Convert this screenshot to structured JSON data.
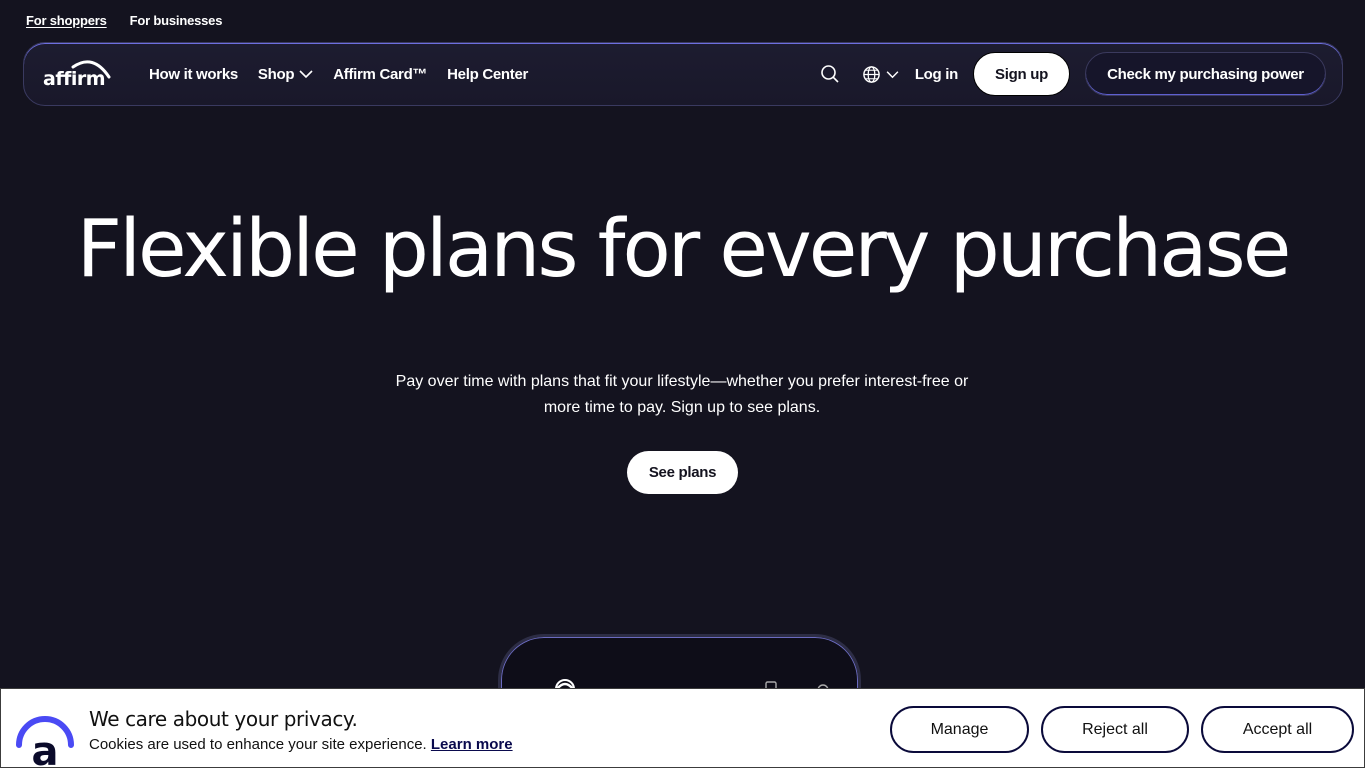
{
  "audience": {
    "shoppers": "For shoppers",
    "businesses": "For businesses"
  },
  "nav": {
    "logo_text": "affirm",
    "links": {
      "how_it_works": "How it works",
      "shop": "Shop",
      "card": "Affirm Card™",
      "help": "Help Center"
    },
    "login": "Log in",
    "signup": "Sign up",
    "check_power": "Check my purchasing power"
  },
  "hero": {
    "title": "Flexible plans for every purchase",
    "subtitle": "Pay over time with plans that fit your lifestyle—whether you prefer interest-free or more time to pay. Sign up to see plans.",
    "cta": "See plans"
  },
  "cookie": {
    "title": "We care about your privacy.",
    "text": "Cookies are used to enhance your site experience.",
    "learn_more": "Learn more",
    "manage": "Manage",
    "reject": "Reject all",
    "accept": "Accept all"
  },
  "colors": {
    "background": "#14131f",
    "accent": "#4a4af4",
    "navy": "#0a0a3a"
  },
  "icons": [
    "search-icon",
    "globe-icon",
    "chevron-down-icon",
    "affirm-logo"
  ]
}
